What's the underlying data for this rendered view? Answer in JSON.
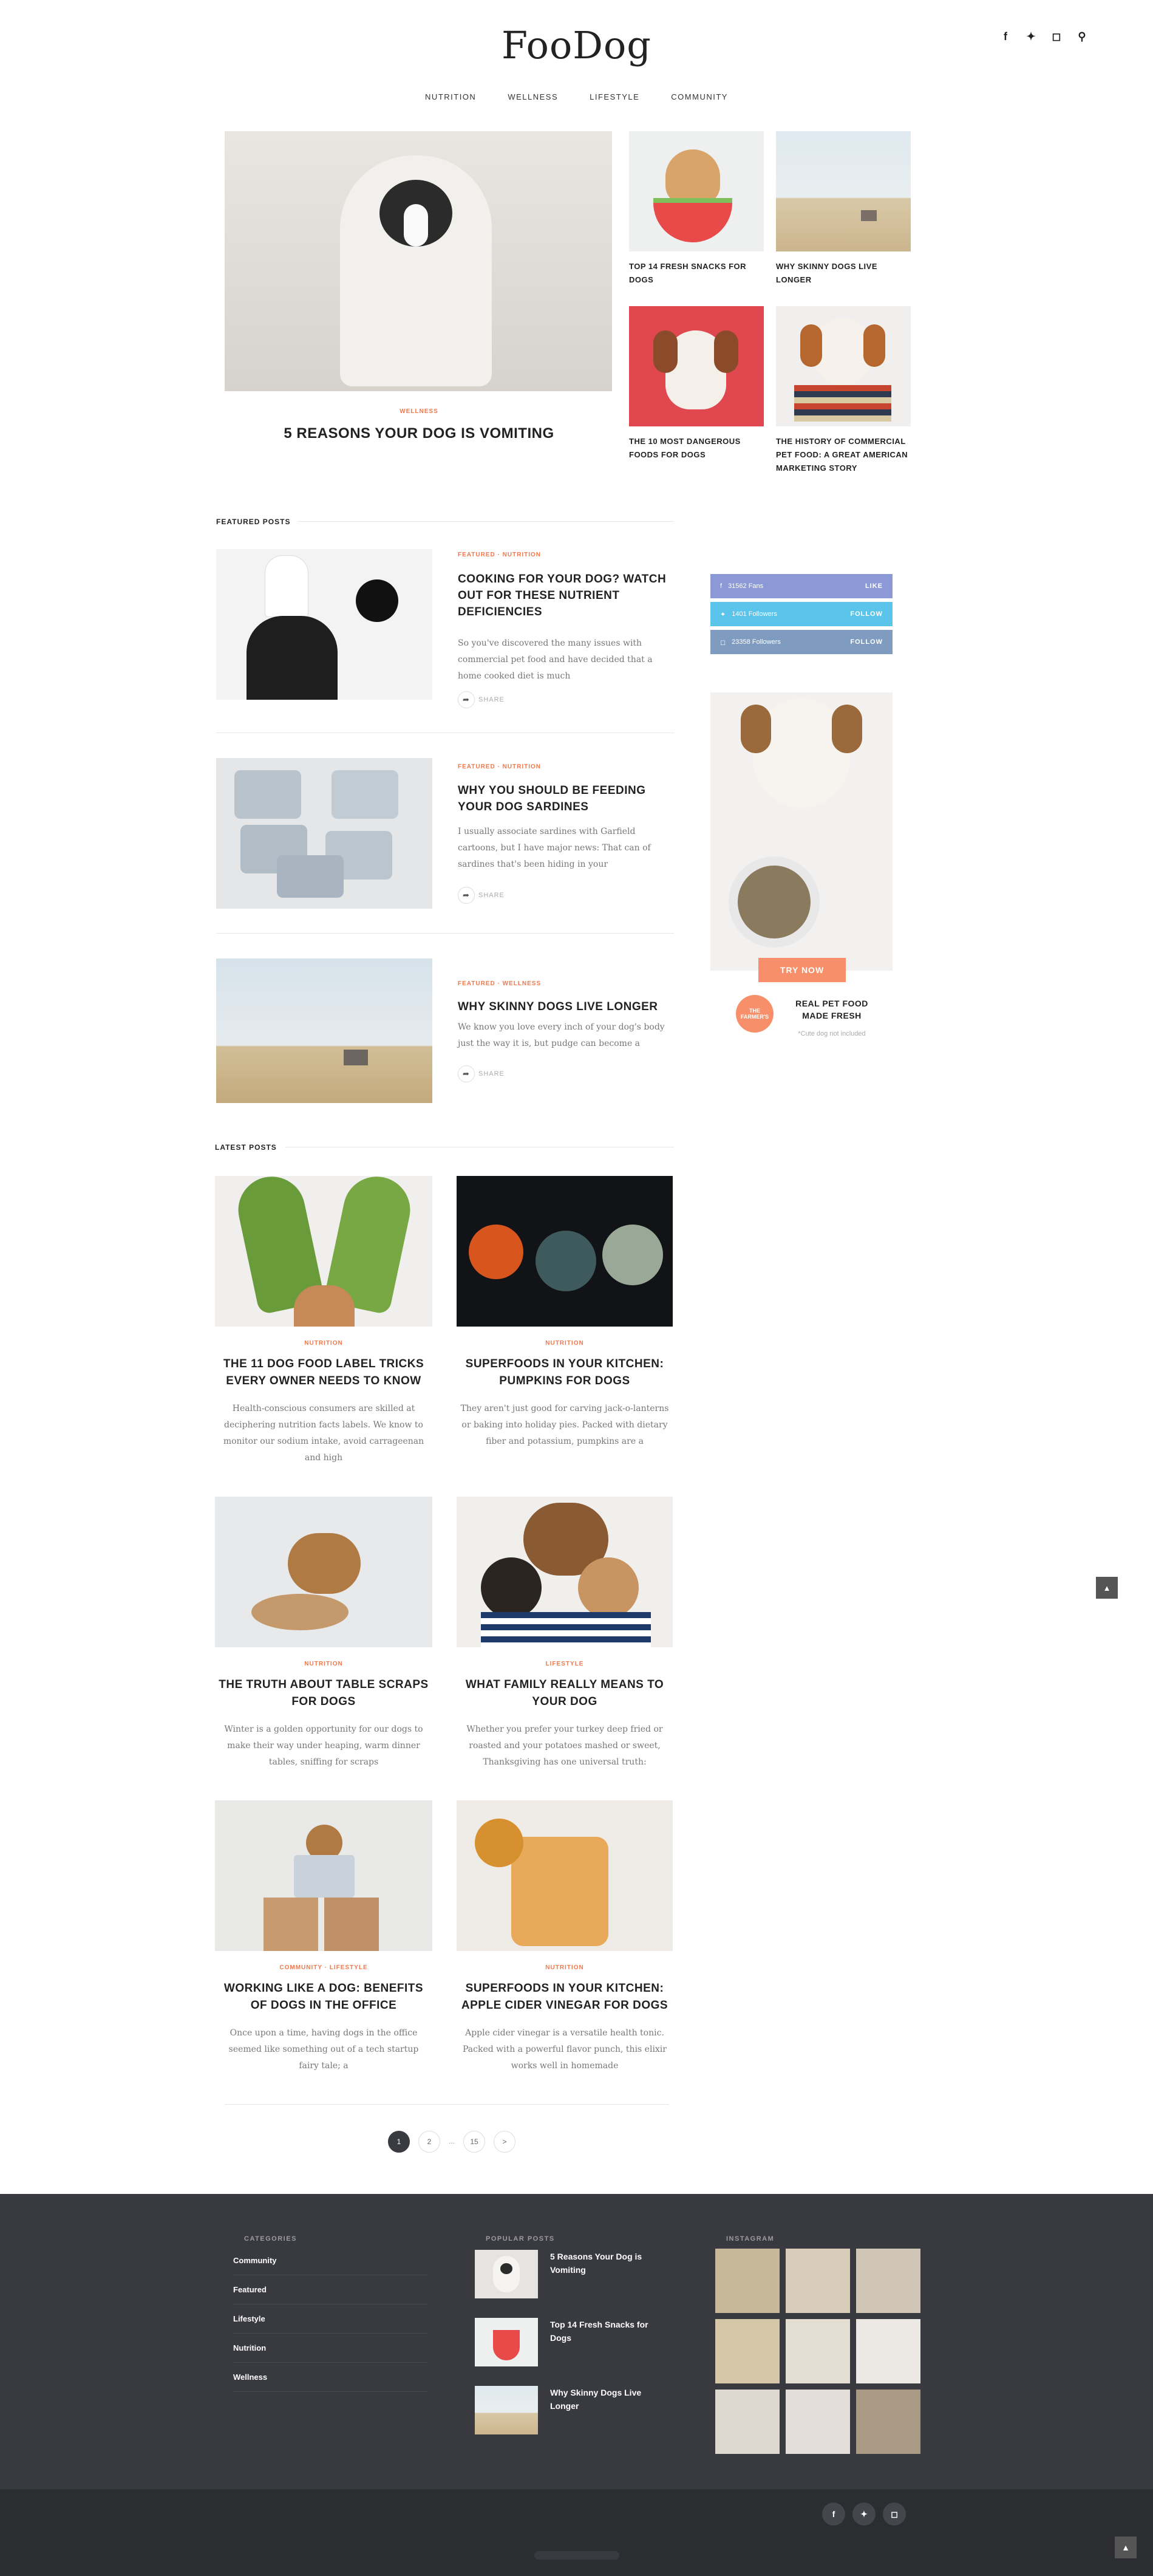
{
  "site": {
    "logo": "FooDog"
  },
  "nav": [
    "NUTRITION",
    "WELLNESS",
    "LIFESTYLE",
    "COMMUNITY"
  ],
  "top_icons": [
    "facebook-icon",
    "twitter-icon",
    "instagram-icon",
    "search-icon"
  ],
  "hero": {
    "main": {
      "category": "WELLNESS",
      "title": "5 REASONS YOUR DOG IS VOMITING"
    },
    "side": [
      {
        "title": "TOP 14 FRESH SNACKS FOR DOGS"
      },
      {
        "title": "WHY SKINNY DOGS LIVE LONGER"
      },
      {
        "title": "THE 10 MOST DANGEROUS FOODS FOR DOGS"
      },
      {
        "title": "THE HISTORY OF COMMERCIAL PET FOOD: A GREAT AMERICAN MARKETING STORY"
      }
    ]
  },
  "featured": {
    "heading": "FEATURED POSTS",
    "share_label": "SHARE",
    "posts": [
      {
        "category": "FEATURED · NUTRITION",
        "title": "COOKING FOR YOUR DOG? WATCH OUT FOR THESE NUTRIENT DEFICIENCIES",
        "excerpt": "So you've discovered the many issues with commercial pet food and have decided that a home cooked diet is much"
      },
      {
        "category": "FEATURED · NUTRITION",
        "title": "WHY YOU SHOULD BE FEEDING YOUR DOG SARDINES",
        "excerpt": "I usually associate sardines with Garfield cartoons, but I have major news: That can of sardines that's been hiding in your"
      },
      {
        "category": "FEATURED · WELLNESS",
        "title": "WHY SKINNY DOGS LIVE LONGER",
        "excerpt": "We know you love every inch of your dog's body just the way it is, but pudge can become a"
      }
    ]
  },
  "sidebar": {
    "social": [
      {
        "icon": "facebook-icon",
        "label": "31562 Fans",
        "action": "LIKE",
        "color": "#8b9ad6"
      },
      {
        "icon": "twitter-icon",
        "label": "1401 Followers",
        "action": "FOLLOW",
        "color": "#5bc4ea"
      },
      {
        "icon": "instagram-icon",
        "label": "23358 Followers",
        "action": "FOLLOW",
        "color": "#7f9cc0"
      }
    ],
    "ad": {
      "button": "TRY NOW",
      "badge": "THE FARMER'S",
      "headline": "REAL PET FOOD MADE FRESH",
      "note": "*Cute dog not included"
    }
  },
  "latest": {
    "heading": "LATEST POSTS",
    "posts": [
      {
        "category": "NUTRITION",
        "title": "THE 11 DOG FOOD LABEL TRICKS EVERY OWNER NEEDS TO KNOW",
        "excerpt": "Health-conscious consumers are skilled at deciphering nutrition facts labels. We know to monitor our sodium intake, avoid carrageenan and high"
      },
      {
        "category": "NUTRITION",
        "title": "SUPERFOODS IN YOUR KITCHEN: PUMPKINS FOR DOGS",
        "excerpt": "They aren't just good for carving jack-o-lanterns or baking into holiday pies. Packed with dietary fiber and potassium, pumpkins are a"
      },
      {
        "category": "NUTRITION",
        "title": "THE TRUTH ABOUT TABLE SCRAPS FOR DOGS",
        "excerpt": "Winter is a golden opportunity for our dogs to make their way under heaping, warm dinner tables, sniffing for scraps"
      },
      {
        "category": "LIFESTYLE",
        "title": "WHAT FAMILY REALLY MEANS TO YOUR DOG",
        "excerpt": "Whether you prefer your turkey deep fried or roasted and your potatoes mashed or sweet, Thanksgiving has one universal truth:"
      },
      {
        "category": "COMMUNITY · LIFESTYLE",
        "title": "WORKING LIKE A DOG: BENEFITS OF DOGS IN THE OFFICE",
        "excerpt": "Once upon a time, having dogs in the office seemed like something out of a tech startup fairy tale; a"
      },
      {
        "category": "NUTRITION",
        "title": "SUPERFOODS IN YOUR KITCHEN: APPLE CIDER VINEGAR FOR DOGS",
        "excerpt": "Apple cider vinegar is a versatile health tonic. Packed with a powerful flavor punch, this elixir works well in homemade"
      }
    ]
  },
  "pagination": {
    "pages": [
      "1",
      "2",
      "15"
    ],
    "dots": "...",
    "next": ">"
  },
  "footer": {
    "categories_heading": "CATEGORIES",
    "categories": [
      "Community",
      "Featured",
      "Lifestyle",
      "Nutrition",
      "Wellness"
    ],
    "popular_heading": "POPULAR POSTS",
    "popular": [
      "5 Reasons Your Dog is Vomiting",
      "Top 14 Fresh Snacks for Dogs",
      "Why Skinny Dogs Live Longer"
    ],
    "instagram_heading": "INSTAGRAM"
  }
}
